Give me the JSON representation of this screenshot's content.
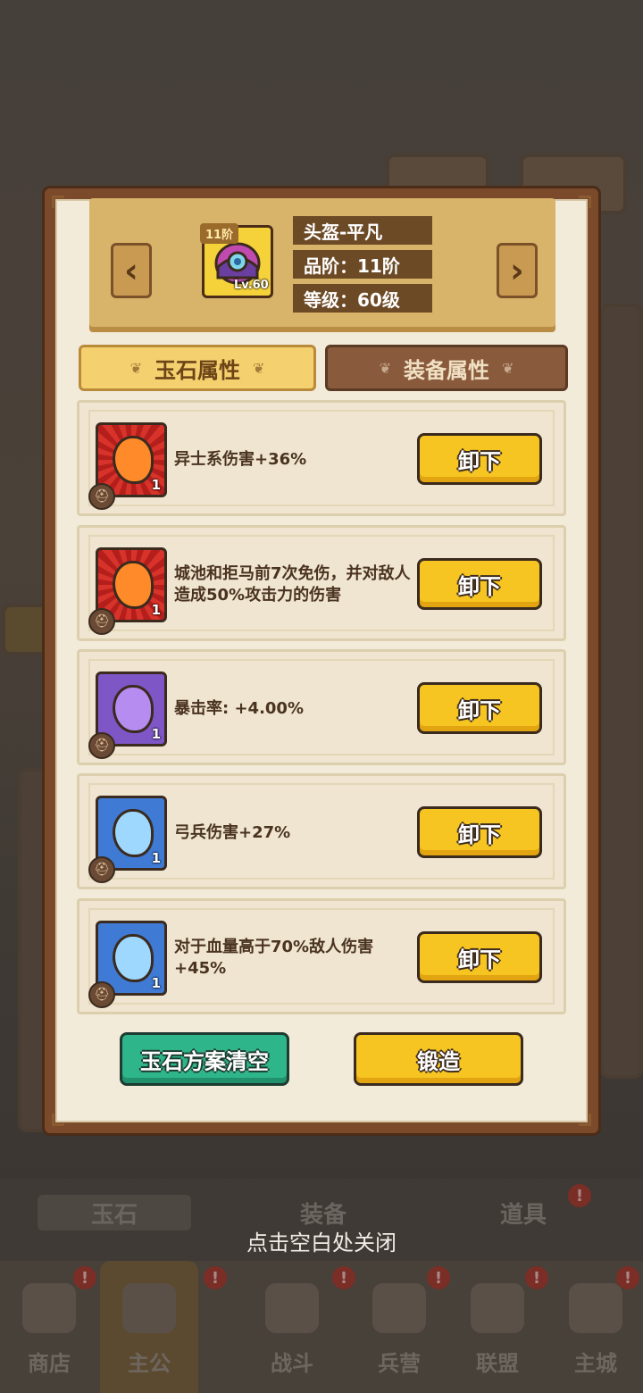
{
  "colors": {
    "frame": "#7b4a2a",
    "paper": "#f3ebda",
    "button_yellow": "#f7c522",
    "button_green": "#2fb58a",
    "tab_active": "#f5d06e",
    "tab_inactive": "#8a5a3c"
  },
  "equipment": {
    "tier_badge": "11阶",
    "level_badge": "Lv.60",
    "name": "头盔-平凡",
    "quality": "品阶：11阶",
    "level": "等级：60级",
    "prev_icon": "chevron-left-icon",
    "next_icon": "chevron-right-icon"
  },
  "tabs": [
    {
      "label": "玉石属性",
      "active": true
    },
    {
      "label": "装备属性",
      "active": false
    }
  ],
  "jades": [
    {
      "color": "red",
      "icon": "jade-red-icon",
      "count": "1",
      "text": "异士系伤害+36%",
      "button": "卸下"
    },
    {
      "color": "red",
      "icon": "jade-red-icon",
      "count": "1",
      "text": "城池和拒马前7次免伤，并对敌人造成50%攻击力的伤害",
      "button": "卸下"
    },
    {
      "color": "purple",
      "icon": "jade-purple-icon",
      "count": "1",
      "text": "暴击率: +4.00%",
      "button": "卸下"
    },
    {
      "color": "blue",
      "icon": "jade-blue-icon",
      "count": "1",
      "text": "弓兵伤害+27%",
      "button": "卸下"
    },
    {
      "color": "blue",
      "icon": "jade-blue-icon",
      "count": "1",
      "text": "对于血量高于70%敌人伤害+45%",
      "button": "卸下"
    }
  ],
  "actions": {
    "clear_label": "玉石方案清空",
    "forge_label": "锻造"
  },
  "close_hint": "点击空白处关闭",
  "background": {
    "bag_tabs": [
      "玉石",
      "装备",
      "道具"
    ],
    "nav": [
      "商店",
      "主公",
      "战斗",
      "兵营",
      "联盟",
      "主城"
    ]
  }
}
